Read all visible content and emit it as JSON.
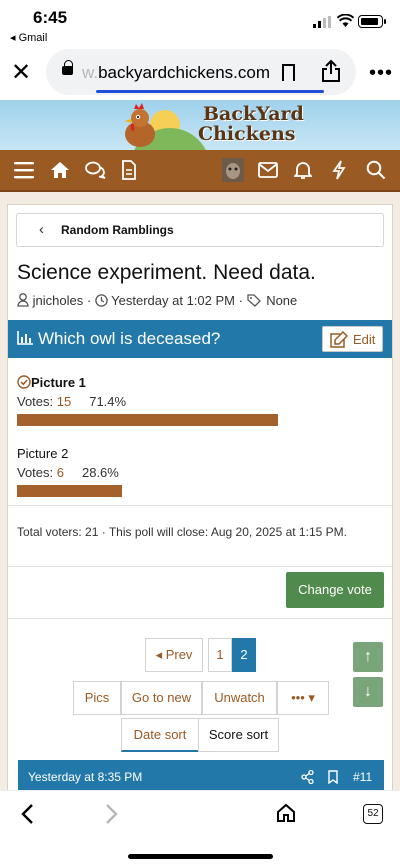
{
  "status_bar": {
    "time": "6:45",
    "back_app": "◂ Gmail"
  },
  "browser": {
    "host_faded": "w.",
    "host": "backyardchickens.com"
  },
  "site": {
    "brand_line1": "BackYard",
    "brand_line2": "Chickens"
  },
  "breadcrumb": {
    "label": "Random Ramblings"
  },
  "thread": {
    "title": "Science experiment. Need data.",
    "author": "jnicholes",
    "sep1": " · ",
    "time": "Yesterday at 1:02 PM",
    "sep2": " · ",
    "tags": "None"
  },
  "poll": {
    "question": "Which owl is deceased?",
    "edit_label": "Edit",
    "options": [
      {
        "name": "Picture 1",
        "votes_label": "Votes: ",
        "votes": "15",
        "percent": "71.4%",
        "fraction": 0.714
      },
      {
        "name": "Picture 2",
        "votes_label": "Votes: ",
        "votes": "6",
        "percent": "28.6%",
        "fraction": 0.286
      }
    ],
    "total": "Total voters: 21 · This poll will close: Aug 20, 2025 at 1:15 PM.",
    "change_vote_label": "Change vote"
  },
  "pager": {
    "prev_label": "◂ Prev",
    "pages": [
      "1",
      "2"
    ],
    "current_page": "2"
  },
  "filters": {
    "pics": "Pics",
    "go_to_new": "Go to new",
    "unwatch": "Unwatch",
    "more": "••• ▾"
  },
  "sort": {
    "date": "Date sort",
    "score": "Score sort"
  },
  "post": {
    "time": "Yesterday at 8:35 PM",
    "number": "#11"
  },
  "toolbar": {
    "tab_count": "52"
  },
  "colors": {
    "brand_brown": "#9a5a24",
    "poll_blue": "#2279a9",
    "vote_green": "#508a4c",
    "bar_color": "#a5612b"
  }
}
